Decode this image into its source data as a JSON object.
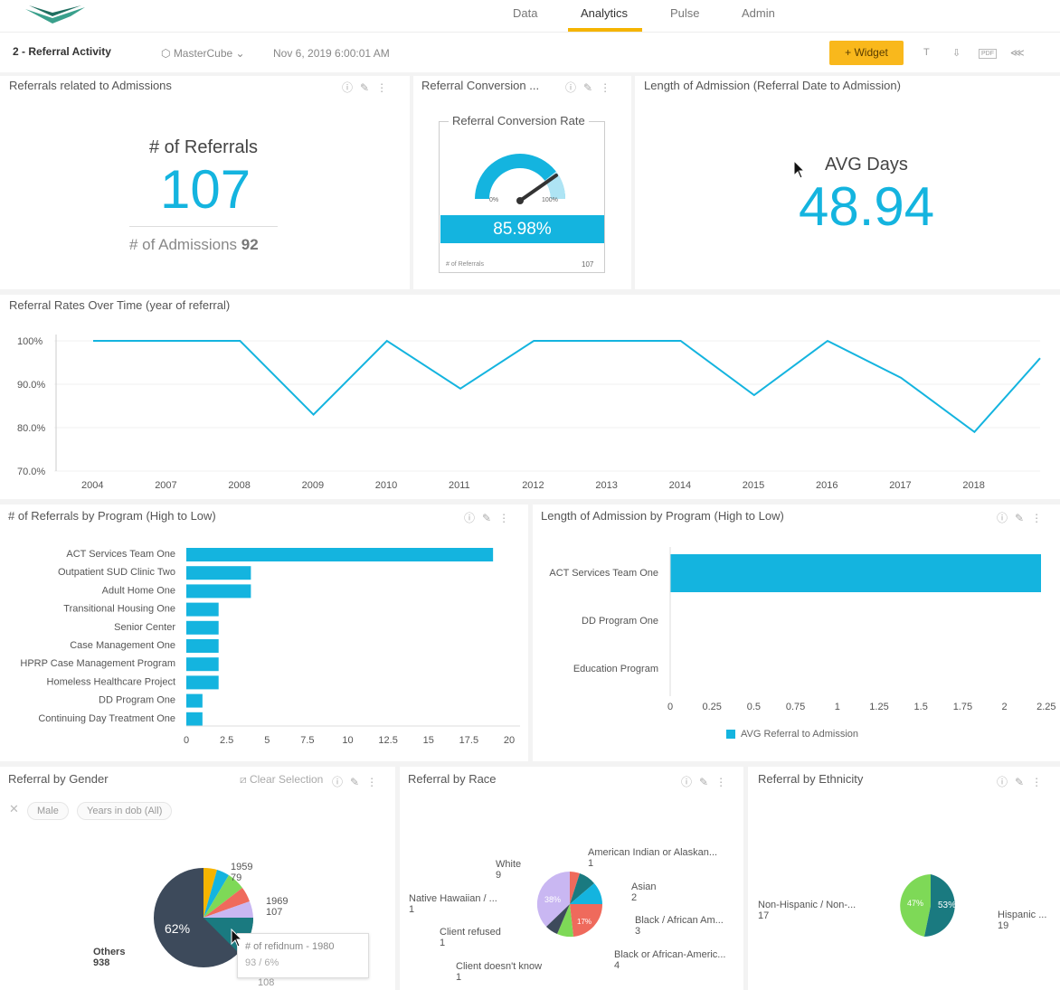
{
  "nav": {
    "tabs": [
      "Data",
      "Analytics",
      "Pulse",
      "Admin"
    ],
    "active": "Analytics"
  },
  "toolbar": {
    "title": "2 - Referral Activity",
    "cube": "MasterCube",
    "date": "Nov 6, 2019 6:00:01 AM",
    "widget_label": "+ Widget"
  },
  "panels": {
    "referrals_admissions": {
      "title": "Referrals related to Admissions",
      "kpi_label": "# of Referrals",
      "kpi_value": "107",
      "secondary_label": "# of Admissions",
      "secondary_value": "92"
    },
    "conversion": {
      "title": "Referral Conversion ...",
      "gauge_title": "Referral Conversion Rate",
      "min_label": "0%",
      "max_label": "100%",
      "value_label": "85.98%",
      "value": 0.8598,
      "footer_label": "# of Referrals",
      "footer_value": "107"
    },
    "length_admission": {
      "title": "Length of Admission (Referral Date to Admission)",
      "kpi_label": "AVG Days",
      "kpi_value": "48.94"
    },
    "rates_time": {
      "title": "Referral Rates Over Time (year of referral)"
    },
    "by_program": {
      "title": "# of Referrals by Program (High to Low)"
    },
    "length_program": {
      "title": "Length of Admission by Program (High to Low)",
      "legend": "AVG Referral to Admission"
    },
    "gender": {
      "title": "Referral by Gender",
      "clear_selection": "Clear Selection",
      "chips": [
        "Male",
        "Years in dob (All)"
      ],
      "center_pct": "62%",
      "labels": [
        {
          "name": "1959",
          "value": "79"
        },
        {
          "name": "1969",
          "value": "107"
        },
        {
          "name": "Others",
          "value": "938"
        },
        {
          "name": "108",
          "value": ""
        }
      ],
      "tooltip_title": "# of refidnum - 1980",
      "tooltip_value": "93 / 6%"
    },
    "race": {
      "title": "Referral by Race",
      "center_pct": "38%",
      "red_pct": "17%",
      "labels": [
        {
          "name": "American Indian or Alaskan...",
          "value": "1"
        },
        {
          "name": "White",
          "value": "9"
        },
        {
          "name": "Asian",
          "value": "2"
        },
        {
          "name": "Native Hawaiian / ...",
          "value": "1"
        },
        {
          "name": "Black / African Am...",
          "value": "3"
        },
        {
          "name": "Client refused",
          "value": "1"
        },
        {
          "name": "Black or African-Americ...",
          "value": "4"
        },
        {
          "name": "Client doesn't know",
          "value": "1"
        }
      ]
    },
    "ethnicity": {
      "title": "Referral by Ethnicity",
      "labels": [
        {
          "name": "Non-Hispanic / Non-...",
          "value": "17"
        },
        {
          "name": "Hispanic ...",
          "value": "19"
        }
      ],
      "pct_a": "47%",
      "pct_b": "53%"
    }
  },
  "chart_data": [
    {
      "type": "line",
      "x": [
        "2004",
        "2007",
        "2008",
        "2009",
        "2010",
        "2011",
        "2012",
        "2013",
        "2014",
        "2015",
        "2016",
        "2017",
        "2018"
      ],
      "y": [
        1.0,
        1.0,
        1.0,
        0.83,
        1.0,
        0.89,
        1.0,
        1.0,
        1.0,
        0.875,
        1.0,
        0.915,
        0.79
      ],
      "y_tick_labels": [
        "100%",
        "90.0%",
        "80.0%",
        "70.0%"
      ],
      "ylim": [
        0.7,
        1.0
      ],
      "color": "#14b4df"
    },
    {
      "type": "bar",
      "orientation": "horizontal",
      "categories": [
        "ACT Services Team One",
        "Outpatient SUD Clinic Two",
        "Adult Home One",
        "Transitional Housing One",
        "Senior Center",
        "Case Management One",
        "HPRP Case Management Program",
        "Homeless Healthcare Project",
        "DD Program One",
        "Continuing Day Treatment One"
      ],
      "values": [
        19,
        4,
        4,
        2,
        2,
        2,
        2,
        2,
        1,
        1
      ],
      "x_ticks": [
        "0",
        "2.5",
        "5",
        "7.5",
        "10",
        "12.5",
        "15",
        "17.5",
        "20"
      ],
      "xlim": [
        0,
        20
      ],
      "color": "#14b4df"
    },
    {
      "type": "bar",
      "orientation": "horizontal",
      "categories": [
        "ACT Services Team One",
        "DD Program One",
        "Education Program"
      ],
      "series": [
        {
          "name": "AVG Referral to Admission",
          "values": [
            2.3,
            0,
            0
          ]
        }
      ],
      "x_ticks": [
        "0",
        "0.25",
        "0.5",
        "0.75",
        "1",
        "1.25",
        "1.5",
        "1.75",
        "2",
        "2.25"
      ],
      "xlim": [
        0,
        2.3
      ],
      "color": "#14b4df"
    }
  ],
  "colors": {
    "accent": "#14b4df",
    "brand": "#f9b81c",
    "dark": "#3d4a5b",
    "green": "#7ed957",
    "teal": "#1a7a80"
  }
}
